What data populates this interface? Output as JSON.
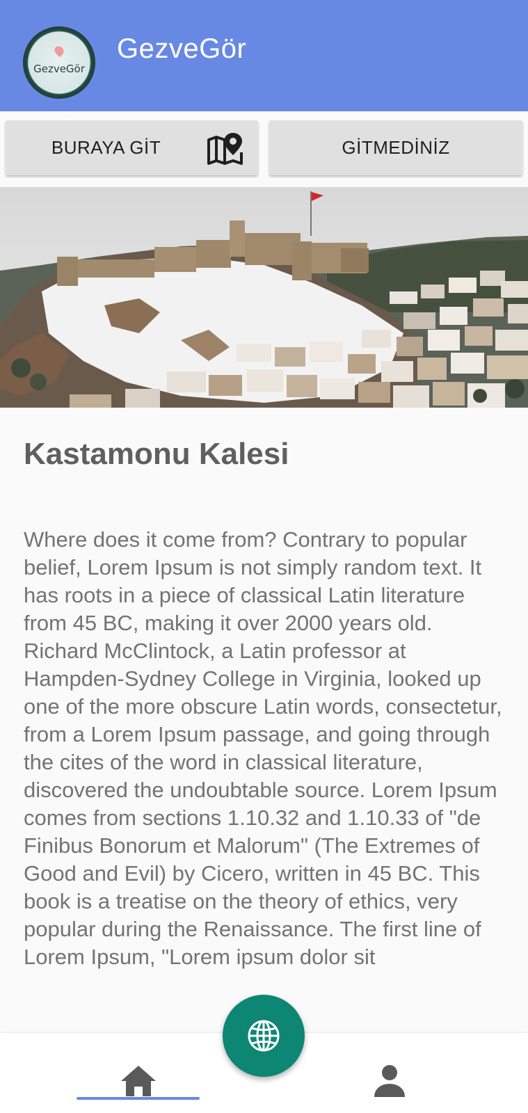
{
  "app": {
    "title": "GezveGör",
    "logo_text": "GezveGör"
  },
  "actions": {
    "go_here_label": "BURAYA GİT",
    "not_visited_label": "GİTMEDİNİZ"
  },
  "place": {
    "name": "Kastamonu Kalesi",
    "description": "Where does it come from? Contrary to popular belief, Lorem Ipsum is not simply random text. It has roots in a piece of classical Latin literature from 45 BC, making it over 2000 years old. Richard McClintock, a Latin professor at Hampden-Sydney College in Virginia, looked up one of the more obscure Latin words, consectetur, from a Lorem Ipsum passage, and going through the cites of the word in classical literature, discovered the undoubtable source. Lorem Ipsum comes from sections 1.10.32 and 1.10.33 of \"de Finibus Bonorum et Malorum\" (The Extremes of Good and Evil) by Cicero, written in 45 BC. This book is a treatise on the theory of ethics, very popular during the Renaissance. The first line of Lorem Ipsum, \"Lorem ipsum dolor sit"
  },
  "icons": {
    "map_pin": "map-pin-icon",
    "globe": "globe-icon",
    "home": "home-icon",
    "profile": "person-icon"
  },
  "colors": {
    "appbar": "#6889e3",
    "fab": "#0d8674",
    "nav_icon": "#5a5a5a"
  }
}
